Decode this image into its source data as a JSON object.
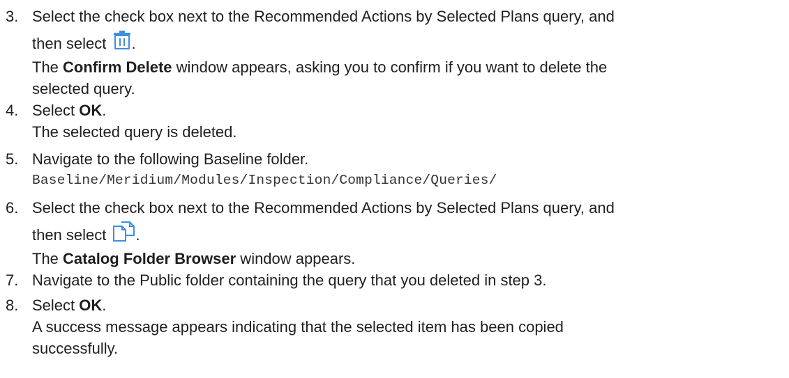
{
  "steps": [
    {
      "number": "3.",
      "text_a": "Select the check box next to the Recommended Actions by Selected Plans query, and",
      "text_b": "then select",
      "icon": "trash-icon",
      "text_b_end": ".",
      "result_a": "The ",
      "result_bold": "Confirm Delete",
      "result_b": " window appears, asking you to confirm if you want to delete the",
      "result_c": "selected query."
    },
    {
      "number": "4.",
      "text_a": "Select ",
      "text_bold": "OK",
      "text_end": ".",
      "result": "The selected query is deleted."
    },
    {
      "number": "5.",
      "text": "Navigate to the following Baseline folder.",
      "path": "Baseline/Meridium/Modules/Inspection/Compliance/Queries/"
    },
    {
      "number": "6.",
      "text_a": "Select the check box next to the Recommended Actions by Selected Plans query, and",
      "text_b": "then select",
      "icon": "copy-icon",
      "text_b_end": ".",
      "result_a": "The ",
      "result_bold": "Catalog Folder Browser",
      "result_b": " window appears."
    },
    {
      "number": "7.",
      "text": "Navigate to the Public folder containing the query that you deleted in step 3."
    },
    {
      "number": "8.",
      "text_a": "Select ",
      "text_bold": "OK",
      "text_end": ".",
      "result_a": "A success message appears indicating that the selected item has been copied",
      "result_b": "successfully."
    }
  ],
  "colors": {
    "text": "#1f1f1f",
    "icon_accent": "#3d8fe0"
  }
}
